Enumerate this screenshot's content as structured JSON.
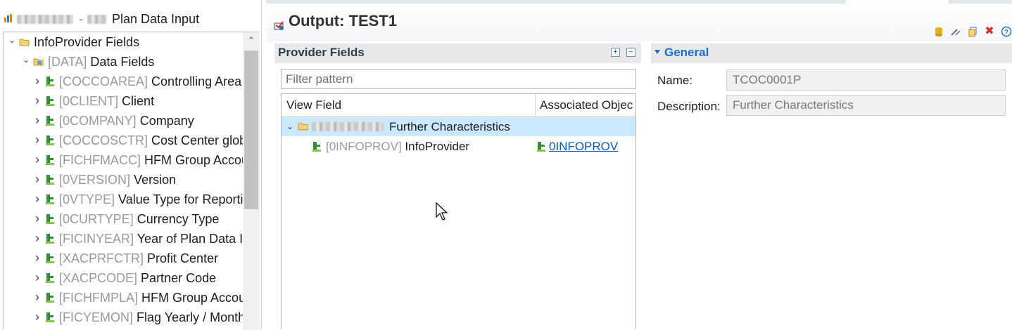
{
  "left_panel": {
    "header_title": "Plan Data Input",
    "header_separator": "-",
    "tree": [
      {
        "level": 0,
        "expanded": true,
        "tech": "",
        "label": "InfoProvider Fields",
        "icon": "folder-icon"
      },
      {
        "level": 1,
        "expanded": true,
        "tech": "[DATA]",
        "label": "Data Fields",
        "icon": "data-folder-icon"
      },
      {
        "level": 2,
        "expanded": false,
        "tech": "[COCCOAREA]",
        "label": "Controlling Area",
        "icon": "characteristic-icon"
      },
      {
        "level": 2,
        "expanded": false,
        "tech": "[0CLIENT]",
        "label": "Client",
        "icon": "characteristic-icon"
      },
      {
        "level": 2,
        "expanded": false,
        "tech": "[0COMPANY]",
        "label": "Company",
        "icon": "characteristic-icon"
      },
      {
        "level": 2,
        "expanded": false,
        "tech": "[COCCOSCTR]",
        "label": "Cost Center globa",
        "icon": "characteristic-icon"
      },
      {
        "level": 2,
        "expanded": false,
        "tech": "[FICHFMACC]",
        "label": "HFM Group Accou",
        "icon": "characteristic-icon"
      },
      {
        "level": 2,
        "expanded": false,
        "tech": "[0VERSION]",
        "label": "Version",
        "icon": "characteristic-icon"
      },
      {
        "level": 2,
        "expanded": false,
        "tech": "[0VTYPE]",
        "label": "Value Type for Reportir",
        "icon": "characteristic-icon"
      },
      {
        "level": 2,
        "expanded": false,
        "tech": "[0CURTYPE]",
        "label": "Currency Type",
        "icon": "characteristic-icon"
      },
      {
        "level": 2,
        "expanded": false,
        "tech": "[FICINYEAR]",
        "label": "Year of Plan Data In",
        "icon": "characteristic-icon"
      },
      {
        "level": 2,
        "expanded": false,
        "tech": "[XACPRFCTR]",
        "label": "Profit Center",
        "icon": "characteristic-icon"
      },
      {
        "level": 2,
        "expanded": false,
        "tech": "[XACPCODE]",
        "label": "Partner Code",
        "icon": "characteristic-icon"
      },
      {
        "level": 2,
        "expanded": false,
        "tech": "[FICHFMPLA]",
        "label": "HFM Group Accou",
        "icon": "characteristic-icon"
      },
      {
        "level": 2,
        "expanded": false,
        "tech": "[FICYEMON]",
        "label": "Flag Yearly / Month",
        "icon": "characteristic-icon"
      }
    ]
  },
  "output": {
    "title": "Output: TEST1",
    "toolbar_icons": [
      "database-icon",
      "edit-icon",
      "copy-icon",
      "delete-icon",
      "help-icon"
    ]
  },
  "provider_fields": {
    "title": "Provider Fields",
    "filter_placeholder": "Filter pattern",
    "columns": [
      "View Field",
      "Associated Objec"
    ],
    "rows": [
      {
        "tech": "",
        "label": "Further Characteristics",
        "associated": "",
        "selected": true
      },
      {
        "tech": "[0INFOPROV]",
        "label": "InfoProvider",
        "associated": "0INFOPROV",
        "selected": false
      }
    ]
  },
  "general": {
    "title": "General",
    "name_label": "Name:",
    "name_value": "TCOC0001P",
    "description_label": "Description:",
    "description_value": "Further Characteristics"
  }
}
